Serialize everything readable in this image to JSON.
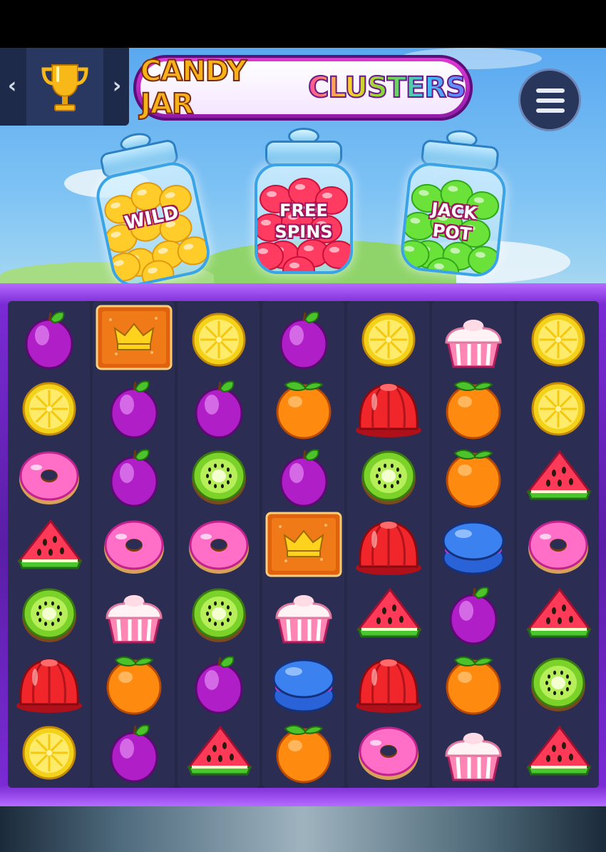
{
  "header": {
    "prev_arrow": "‹",
    "next_arrow": "›",
    "trophy_icon": "trophy-icon",
    "logo_word1": "CANDY JAR",
    "logo_word2": "CLUSTERS",
    "menu_icon": "hamburger-menu-icon"
  },
  "jars": [
    {
      "label_line1": "WILD",
      "label_line2": "",
      "candy_color": "#ffcc2a",
      "candy_dark": "#e09a10"
    },
    {
      "label_line1": "FREE",
      "label_line2": "SPINS",
      "candy_color": "#ff3b62",
      "candy_dark": "#c8123a"
    },
    {
      "label_line1": "JACK",
      "label_line2": "POT",
      "candy_color": "#6be23a",
      "candy_dark": "#2fa819"
    }
  ],
  "board": {
    "columns": [
      [
        "plum",
        "lemon",
        "donut",
        "watermelon",
        "kiwi",
        "jelly",
        "lemon"
      ],
      [
        "wild",
        "plum",
        "plum",
        "donut",
        "cupcake",
        "orange",
        "plum"
      ],
      [
        "lemon",
        "plum",
        "kiwi",
        "donut",
        "kiwi",
        "plum",
        "watermelon"
      ],
      [
        "plum",
        "orange",
        "plum",
        "wild",
        "cupcake",
        "macaron",
        "orange"
      ],
      [
        "lemon",
        "jelly",
        "kiwi",
        "jelly",
        "watermelon",
        "jelly",
        "donut"
      ],
      [
        "cupcake",
        "orange",
        "orange",
        "macaron",
        "plum",
        "orange",
        "cupcake"
      ],
      [
        "lemon",
        "lemon",
        "watermelon",
        "donut",
        "watermelon",
        "kiwi",
        "watermelon"
      ]
    ]
  },
  "colors": {
    "frame_purple": "#7a2bd4",
    "board_bg": "#262848"
  }
}
